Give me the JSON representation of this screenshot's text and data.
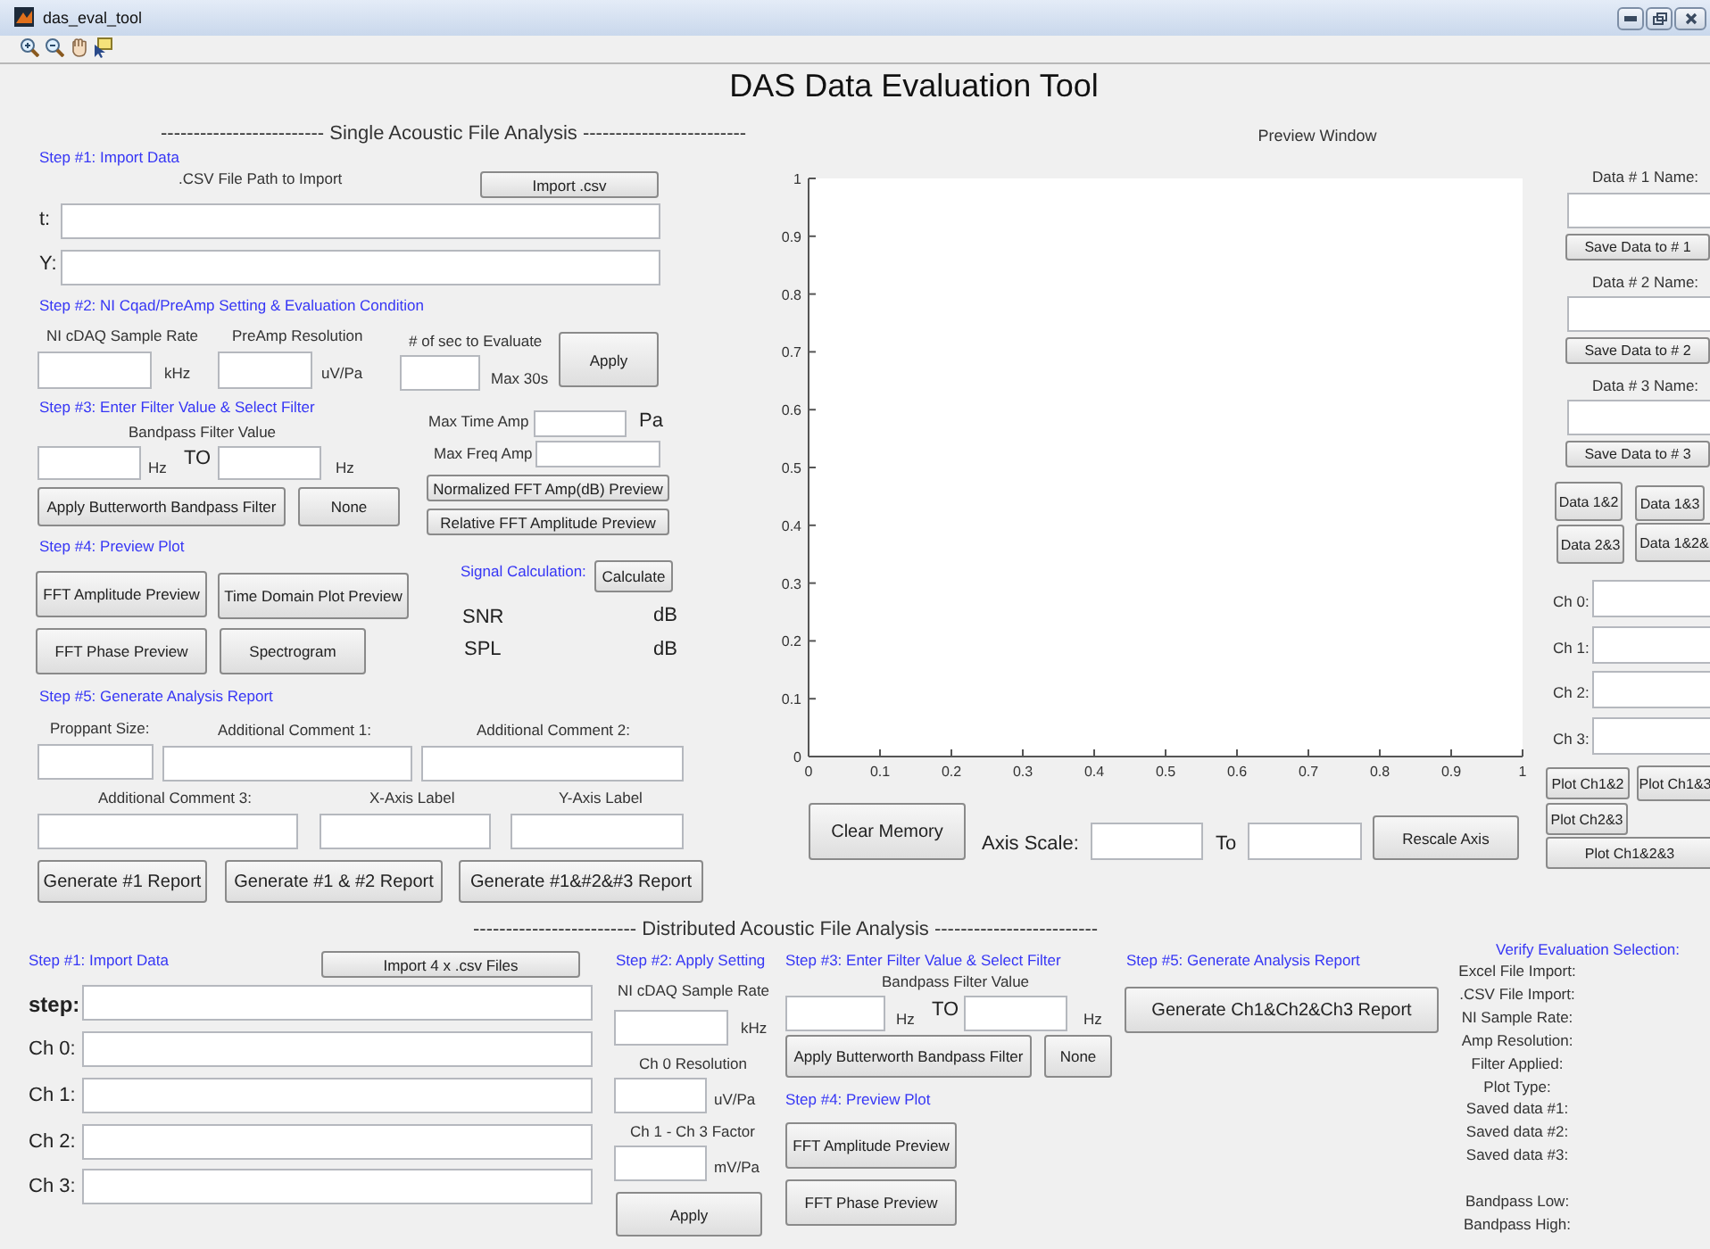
{
  "window": {
    "title": "das_eval_tool"
  },
  "app_title": "DAS Data Evaluation Tool",
  "single_analysis": {
    "header": "------------------------- Single Acoustic File Analysis -------------------------",
    "controls": [
      {
        "kind": "heading",
        "text": "Step #1: Import Data"
      },
      {
        "kind": "label",
        "text": ".CSV File Path to Import"
      },
      {
        "kind": "button",
        "text": "Import .csv"
      },
      {
        "kind": "large-label",
        "text": "t:"
      },
      {
        "kind": "field"
      },
      {
        "kind": "large-label",
        "text": "Y:"
      },
      {
        "kind": "field"
      },
      {
        "kind": "heading",
        "text": "Step #2: NI Cqad/PreAmp Setting & Evaluation Condition"
      },
      {
        "kind": "label",
        "text": "NI cDAQ Sample Rate"
      },
      {
        "kind": "field"
      },
      {
        "kind": "label",
        "text": "kHz"
      },
      {
        "kind": "label",
        "text": "PreAmp Resolution"
      },
      {
        "kind": "field"
      },
      {
        "kind": "label",
        "text": "uV/Pa"
      },
      {
        "kind": "label",
        "text": "# of sec to Evaluate"
      },
      {
        "kind": "field"
      },
      {
        "kind": "label",
        "text": "Max 30s"
      },
      {
        "kind": "button",
        "text": "Apply"
      },
      {
        "kind": "heading",
        "text": "Step #3: Enter Filter Value & Select Filter"
      },
      {
        "kind": "label",
        "text": "Bandpass Filter Value"
      },
      {
        "kind": "field"
      },
      {
        "kind": "label",
        "text": "Hz"
      },
      {
        "kind": "large-label",
        "text": "TO"
      },
      {
        "kind": "field"
      },
      {
        "kind": "label",
        "text": "Hz"
      },
      {
        "kind": "label",
        "text": "Max Time Amp"
      },
      {
        "kind": "field"
      },
      {
        "kind": "large-label",
        "text": "Pa"
      },
      {
        "kind": "label",
        "text": "Max Freq Amp"
      },
      {
        "kind": "field"
      },
      {
        "kind": "button",
        "text": "Normalized FFT Amp(dB) Preview"
      },
      {
        "kind": "button",
        "text": "Relative FFT Amplitude Preview"
      },
      {
        "kind": "button",
        "text": "Apply Butterworth Bandpass Filter"
      },
      {
        "kind": "button",
        "text": "None"
      },
      {
        "kind": "heading",
        "text": "Step #4: Preview Plot"
      },
      {
        "kind": "button",
        "text": "FFT Amplitude Preview"
      },
      {
        "kind": "button",
        "text": "Time Domain Plot Preview"
      },
      {
        "kind": "heading",
        "text": "Signal Calculation:"
      },
      {
        "kind": "button",
        "text": "Calculate"
      },
      {
        "kind": "large-label",
        "text": "SNR"
      },
      {
        "kind": "large-label",
        "text": "dB"
      },
      {
        "kind": "button",
        "text": "FFT Phase Preview"
      },
      {
        "kind": "button",
        "text": "Spectrogram"
      },
      {
        "kind": "large-label",
        "text": "SPL"
      },
      {
        "kind": "large-label",
        "text": "dB"
      },
      {
        "kind": "heading",
        "text": "Step #5: Generate Analysis Report"
      },
      {
        "kind": "label",
        "text": "Proppant Size:"
      },
      {
        "kind": "label",
        "text": "Additional Comment 1:"
      },
      {
        "kind": "label",
        "text": "Additional Comment 2:"
      },
      {
        "kind": "field"
      },
      {
        "kind": "field"
      },
      {
        "kind": "field"
      },
      {
        "kind": "label",
        "text": "Additional Comment 3:"
      },
      {
        "kind": "label",
        "text": "X-Axis Label"
      },
      {
        "kind": "label",
        "text": "Y-Axis Label"
      },
      {
        "kind": "field"
      },
      {
        "kind": "field"
      },
      {
        "kind": "field"
      },
      {
        "kind": "large-button",
        "text": "Generate #1 Report"
      },
      {
        "kind": "large-button",
        "text": "Generate #1 & #2 Report"
      },
      {
        "kind": "large-button",
        "text": "Generate #1&#2&#3 Report"
      }
    ]
  },
  "preview": {
    "chart_data": {
      "type": "line",
      "title": "Preview Window",
      "xlim": [
        0,
        1
      ],
      "ylim": [
        0,
        1
      ],
      "xticks": [
        0,
        0.1,
        0.2,
        0.3,
        0.4,
        0.5,
        0.6,
        0.7,
        0.8,
        0.9,
        1
      ],
      "yticks": [
        0,
        0.1,
        0.2,
        0.3,
        0.4,
        0.5,
        0.6,
        0.7,
        0.8,
        0.9,
        1
      ]
    },
    "controls": [
      {
        "kind": "large-button",
        "text": "Clear Memory"
      },
      {
        "kind": "large-label",
        "text": "Axis Scale:"
      },
      {
        "kind": "field"
      },
      {
        "kind": "large-label",
        "text": "To"
      },
      {
        "kind": "field"
      },
      {
        "kind": "button",
        "text": "Rescale Axis"
      }
    ]
  },
  "data_slots": {
    "controls": [
      {
        "kind": "label",
        "text": "Data # 1 Name:"
      },
      {
        "kind": "field"
      },
      {
        "kind": "small-button",
        "text": "Save Data to # 1"
      },
      {
        "kind": "label",
        "text": "Data # 2 Name:"
      },
      {
        "kind": "field"
      },
      {
        "kind": "small-button",
        "text": "Save Data to # 2"
      },
      {
        "kind": "label",
        "text": "Data # 3 Name:"
      },
      {
        "kind": "field"
      },
      {
        "kind": "small-button",
        "text": "Save Data to # 3"
      },
      {
        "kind": "small-button",
        "text": "Data 1&2"
      },
      {
        "kind": "small-button",
        "text": "Data 1&3"
      },
      {
        "kind": "small-button",
        "text": "Data 2&3"
      },
      {
        "kind": "small-button",
        "text": "Data 1&2&"
      },
      {
        "kind": "label",
        "text": "Ch 0:"
      },
      {
        "kind": "field"
      },
      {
        "kind": "label",
        "text": "Ch 1:"
      },
      {
        "kind": "field"
      },
      {
        "kind": "label",
        "text": "Ch 2:"
      },
      {
        "kind": "field"
      },
      {
        "kind": "label",
        "text": "Ch 3:"
      },
      {
        "kind": "field"
      },
      {
        "kind": "small-button",
        "text": "Plot Ch1&2"
      },
      {
        "kind": "small-button",
        "text": "Plot Ch1&3"
      },
      {
        "kind": "small-button",
        "text": "Plot Ch2&3"
      },
      {
        "kind": "small-button",
        "text": "Plot Ch1&2&3"
      }
    ]
  },
  "distributed_analysis": {
    "header": "------------------------- Distributed Acoustic File Analysis -------------------------",
    "controls": [
      {
        "kind": "heading",
        "text": "Step #1: Import Data"
      },
      {
        "kind": "button",
        "text": "Import 4 x .csv Files"
      },
      {
        "kind": "bold-label",
        "text": "step:"
      },
      {
        "kind": "field"
      },
      {
        "kind": "large-label",
        "text": "Ch 0:"
      },
      {
        "kind": "field"
      },
      {
        "kind": "large-label",
        "text": "Ch 1:"
      },
      {
        "kind": "field"
      },
      {
        "kind": "large-label",
        "text": "Ch 2:"
      },
      {
        "kind": "field"
      },
      {
        "kind": "large-label",
        "text": "Ch 3:"
      },
      {
        "kind": "field"
      },
      {
        "kind": "heading",
        "text": "Step #2: Apply Setting"
      },
      {
        "kind": "label",
        "text": "NI cDAQ Sample Rate"
      },
      {
        "kind": "field"
      },
      {
        "kind": "label",
        "text": "kHz"
      },
      {
        "kind": "label",
        "text": "Ch 0 Resolution"
      },
      {
        "kind": "field"
      },
      {
        "kind": "label",
        "text": "uV/Pa"
      },
      {
        "kind": "label",
        "text": "Ch 1 - Ch 3 Factor"
      },
      {
        "kind": "field"
      },
      {
        "kind": "label",
        "text": "mV/Pa"
      },
      {
        "kind": "button",
        "text": "Apply"
      },
      {
        "kind": "heading",
        "text": "Step #3: Enter Filter Value & Select Filter"
      },
      {
        "kind": "label",
        "text": "Bandpass Filter Value"
      },
      {
        "kind": "field"
      },
      {
        "kind": "label",
        "text": "Hz"
      },
      {
        "kind": "large-label",
        "text": "TO"
      },
      {
        "kind": "field"
      },
      {
        "kind": "label",
        "text": "Hz"
      },
      {
        "kind": "button",
        "text": "Apply Butterworth Bandpass Filter"
      },
      {
        "kind": "button",
        "text": "None"
      },
      {
        "kind": "heading",
        "text": "Step #4: Preview Plot"
      },
      {
        "kind": "button",
        "text": "FFT Amplitude Preview"
      },
      {
        "kind": "button",
        "text": "FFT Phase Preview"
      },
      {
        "kind": "heading",
        "text": "Step #5: Generate Analysis Report"
      },
      {
        "kind": "large-button",
        "text": "Generate Ch1&Ch2&Ch3 Report"
      }
    ]
  },
  "verify": {
    "title": "Verify Evaluation Selection:",
    "items": [
      "Excel File Import:",
      ".CSV File Import:",
      "NI Sample Rate:",
      "Amp Resolution:",
      "Filter Applied:",
      "Plot Type:",
      "Saved data #1:",
      "Saved data #2:",
      "Saved data #3:",
      "Bandpass Low:",
      "Bandpass High:"
    ]
  }
}
